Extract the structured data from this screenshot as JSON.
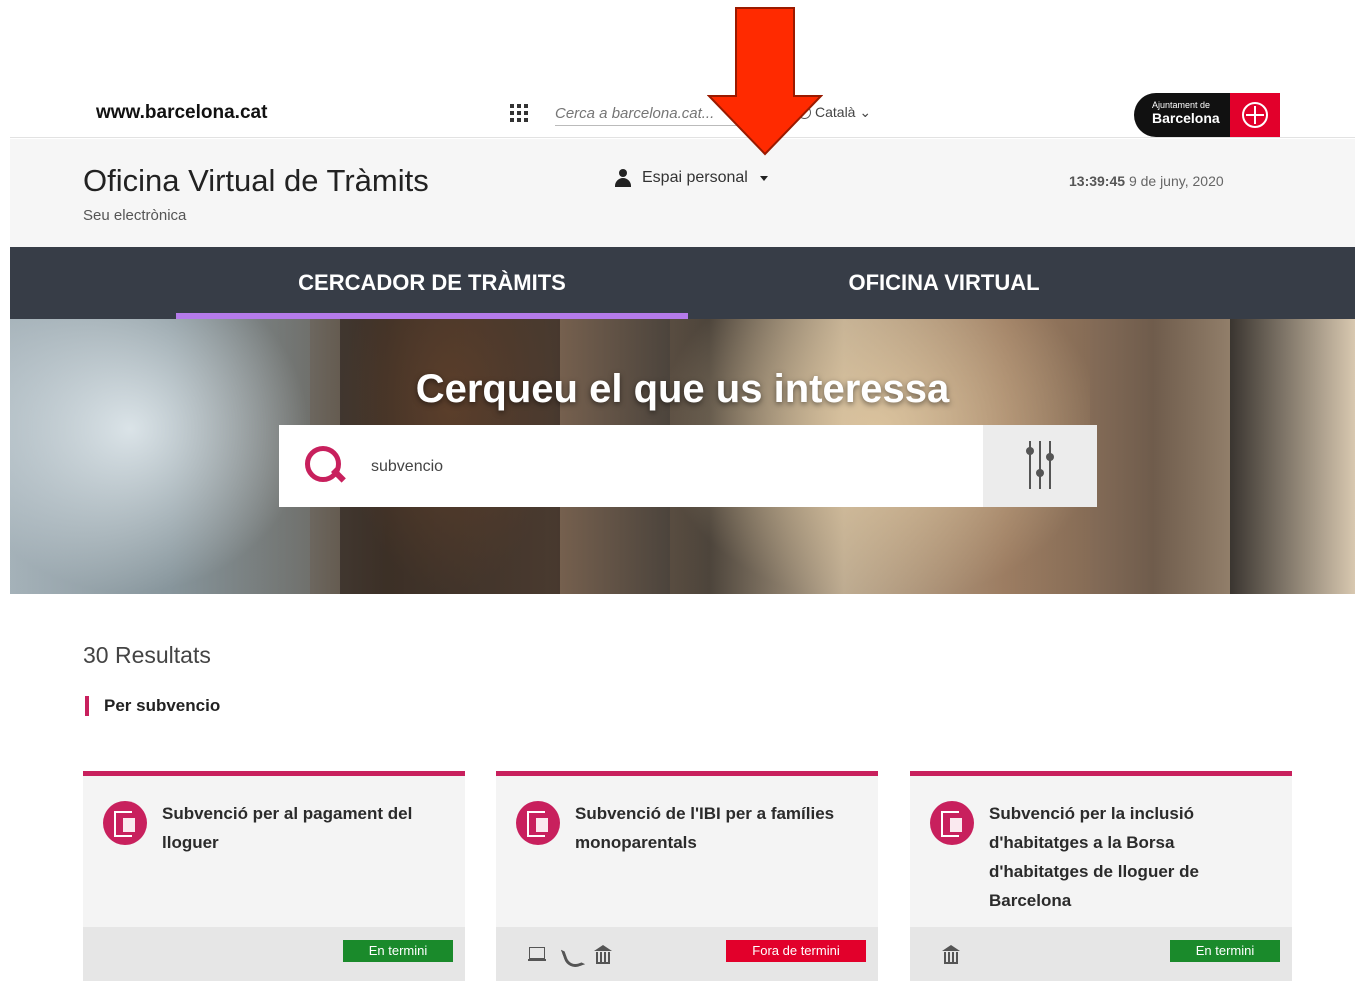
{
  "topbar": {
    "site_link": "www.barcelona.cat",
    "search_placeholder": "Cerca a barcelona.cat...",
    "language": "Català",
    "logo_small": "Ajuntament de",
    "logo_big": "Barcelona"
  },
  "header": {
    "title": "Oficina Virtual de Tràmits",
    "subtitle": "Seu electrònica",
    "personal_space": "Espai personal",
    "time": "13:39:45",
    "date": "9 de juny, 2020"
  },
  "nav": {
    "tabs": [
      {
        "label": "CERCADOR DE TRÀMITS",
        "active": true
      },
      {
        "label": "OFICINA VIRTUAL",
        "active": false
      }
    ],
    "active_color": "#b57bea"
  },
  "hero": {
    "title": "Cerqueu el que us interessa",
    "search_value": "subvencio"
  },
  "results": {
    "count_label": "30 Resultats",
    "filter_label": "Per subvencio",
    "cards": [
      {
        "title": "Subvenció per al pagament del lloguer",
        "status": "En termini",
        "status_color": "#1a8a2b",
        "channels": []
      },
      {
        "title": "Subvenció de l'IBI per a famílies monoparentals",
        "status": "Fora de termini",
        "status_color": "#e2002b",
        "channels": [
          "laptop-icon",
          "phone-icon",
          "building-icon"
        ]
      },
      {
        "title": "Subvenció per la inclusió d'habitatges a la Borsa d'habitatges de lloguer de Barcelona",
        "status": "En termini",
        "status_color": "#1a8a2b",
        "channels": [
          "building-icon"
        ]
      }
    ]
  },
  "colors": {
    "accent": "#c8205d",
    "nav_bg": "#373d47",
    "annotation_arrow": "#ff2a00"
  }
}
